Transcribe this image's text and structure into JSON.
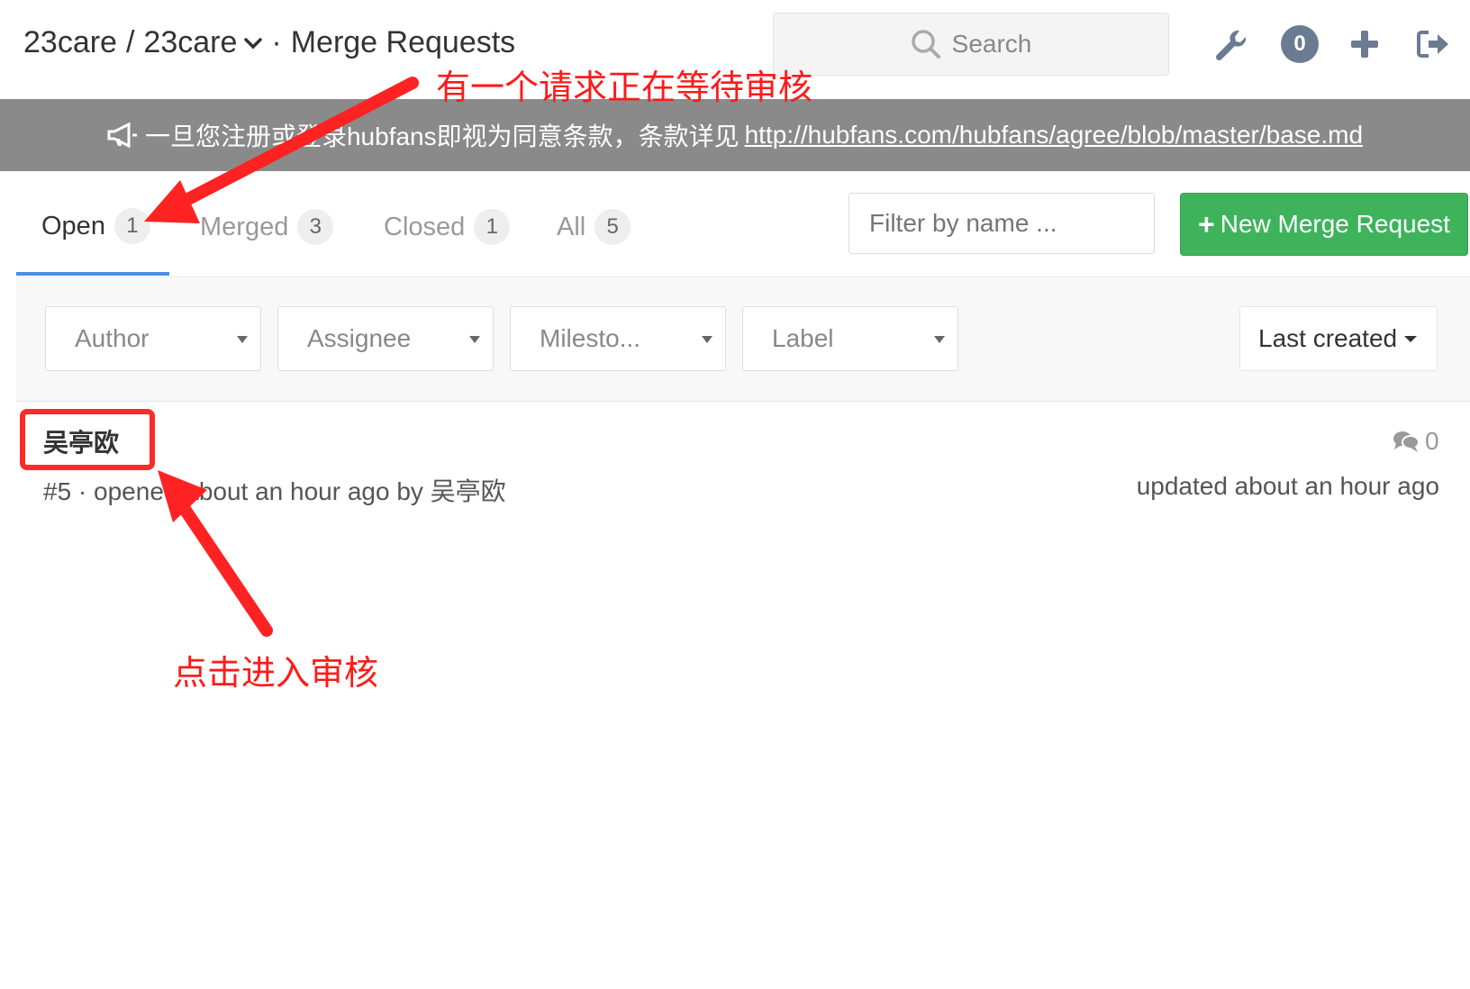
{
  "header": {
    "breadcrumb_group": "23care",
    "breadcrumb_separator": "/",
    "breadcrumb_project": "23care",
    "breadcrumb_dot": "·",
    "page_title": "Merge Requests",
    "search_placeholder": "Search",
    "todo_count": "0",
    "icons": [
      "wrench-icon",
      "plus-icon",
      "sign-out-icon"
    ]
  },
  "banner": {
    "text": "一旦您注册或登录hubfans即视为同意条款，条款详见",
    "link": "http://hubfans.com/hubfans/agree/blob/master/base.md"
  },
  "tabs": [
    {
      "label": "Open",
      "count": "1"
    },
    {
      "label": "Merged",
      "count": "3"
    },
    {
      "label": "Closed",
      "count": "1"
    },
    {
      "label": "All",
      "count": "5"
    }
  ],
  "filter_placeholder": "Filter by name ...",
  "new_mr_label": "New Merge Request",
  "filters": {
    "author": "Author",
    "assignee": "Assignee",
    "milestone": "Milesto...",
    "label": "Label",
    "sort": "Last created"
  },
  "merge_request": {
    "title": "吴亭欧",
    "meta": "#5 · opened about an hour ago by 吴亭欧",
    "comments": "0",
    "updated": "updated about an hour ago"
  },
  "annotations": {
    "top": "有一个请求正在等待审核",
    "bottom": "点击进入审核"
  },
  "colors": {
    "accent_green": "#3fb35c",
    "active_tab_underline": "#4a8fe0",
    "banner_bg": "#8a8a8a",
    "annotation_red": "#ff1a1a"
  }
}
